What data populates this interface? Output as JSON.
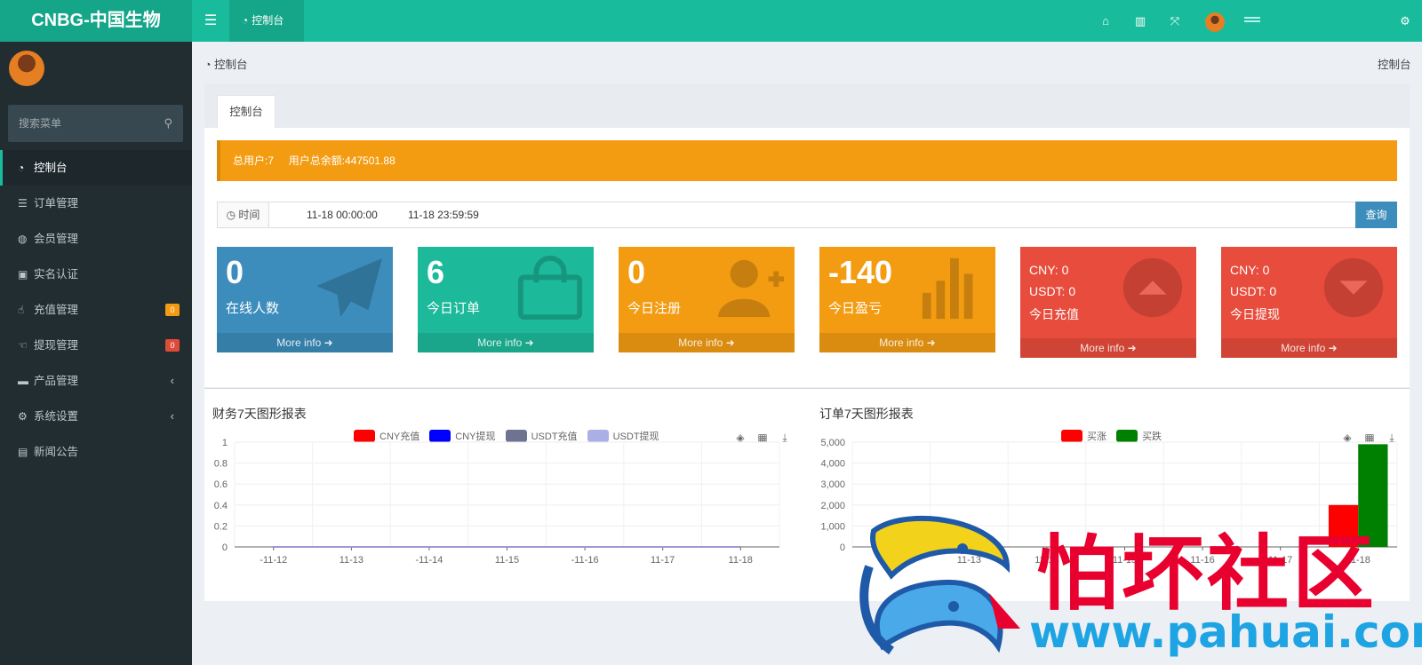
{
  "app": {
    "logo": "CNBG-中国生物"
  },
  "header": {
    "tab_label": "控制台"
  },
  "sidebar": {
    "search_placeholder": "搜索菜单",
    "items": [
      {
        "label": "控制台",
        "icon": "dashboard-icon"
      },
      {
        "label": "订单管理",
        "icon": "list-icon"
      },
      {
        "label": "会员管理",
        "icon": "users-icon"
      },
      {
        "label": "实名认证",
        "icon": "id-card-icon"
      },
      {
        "label": "充值管理",
        "icon": "hand-point-icon",
        "badge": "0",
        "badge_color": "#f39c12"
      },
      {
        "label": "提现管理",
        "icon": "hand-point-left-icon",
        "badge": "0",
        "badge_color": "#dd4b39"
      },
      {
        "label": "产品管理",
        "icon": "briefcase-icon",
        "arrow": "‹"
      },
      {
        "label": "系统设置",
        "icon": "cogs-icon",
        "arrow": "‹"
      },
      {
        "label": "新闻公告",
        "icon": "newspaper-icon"
      }
    ]
  },
  "breadcrumb": {
    "left": "控制台",
    "right": "控制台"
  },
  "panel": {
    "tab": "控制台"
  },
  "alert": {
    "total_users": "总用户:7",
    "total_balance": "用户总余额:447501.88"
  },
  "filter": {
    "label": "时间",
    "start": "11-18 00:00:00",
    "end": "11-18 23:59:59",
    "button": "查询"
  },
  "stats": [
    {
      "value": "0",
      "label": "在线人数",
      "footer": "More info",
      "color": "#3c8dbc",
      "icon": "paper-plane-icon"
    },
    {
      "value": "6",
      "label": "今日订单",
      "footer": "More info",
      "color": "#1cb99a",
      "icon": "shopping-bag-icon"
    },
    {
      "value": "0",
      "label": "今日注册",
      "footer": "More info",
      "color": "#f39c12",
      "icon": "user-plus-icon"
    },
    {
      "value": "-140",
      "label": "今日盈亏",
      "footer": "More info",
      "color": "#f39c12",
      "icon": "bar-chart-icon"
    },
    {
      "cny": "CNY:  0",
      "usdt": "USDT:  0",
      "label": "今日充值",
      "footer": "More info",
      "color": "#e74c3c",
      "icon": "arrow-up-circle-icon"
    },
    {
      "cny": "CNY:  0",
      "usdt": "USDT:  0",
      "label": "今日提现",
      "footer": "More info",
      "color": "#e74c3c",
      "icon": "arrow-down-circle-icon"
    }
  ],
  "watermark": {
    "text": "怕坏社区",
    "url": "www.pahuai.com"
  },
  "chart_data": [
    {
      "type": "line",
      "title": "财务7天图形报表",
      "categories": [
        "-11-12",
        "11-13",
        "-11-14",
        "11-15",
        "-11-16",
        "11-17",
        "11-18"
      ],
      "ylim": [
        0,
        1
      ],
      "yticks": [
        "0",
        "0.2",
        "0.4",
        "0.6",
        "0.8",
        "1"
      ],
      "series": [
        {
          "name": "CNY充值",
          "color": "#ff0000",
          "values": [
            0,
            0,
            0,
            0,
            0,
            0,
            0
          ]
        },
        {
          "name": "CNY提现",
          "color": "#0000ff",
          "values": [
            0,
            0,
            0,
            0,
            0,
            0,
            0
          ]
        },
        {
          "name": "USDT充值",
          "color": "#6e7391",
          "values": [
            0,
            0,
            0,
            0,
            0,
            0,
            0
          ]
        },
        {
          "name": "USDT提现",
          "color": "#aab0e6",
          "values": [
            0,
            0,
            0,
            0,
            0,
            0,
            0
          ]
        }
      ],
      "grid": true,
      "legend": "top"
    },
    {
      "type": "bar",
      "title": "订单7天图形报表",
      "categories": [
        "11-12",
        "11-13",
        "11-14",
        "11-15",
        "11-16",
        "11-17",
        "11-18"
      ],
      "ylim": [
        0,
        5000
      ],
      "yticks": [
        "0",
        "1,000",
        "2,000",
        "3,000",
        "4,000",
        "5,000"
      ],
      "series": [
        {
          "name": "买涨",
          "color": "#ff0000",
          "values": [
            0,
            0,
            0,
            0,
            0,
            0,
            2000
          ]
        },
        {
          "name": "买跌",
          "color": "#008000",
          "values": [
            0,
            0,
            0,
            0,
            0,
            0,
            4900
          ]
        }
      ],
      "grid": true,
      "legend": "top"
    }
  ]
}
